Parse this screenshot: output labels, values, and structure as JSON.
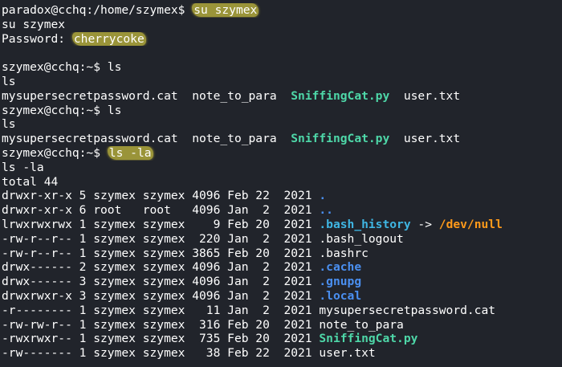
{
  "prompt": {
    "root": "paradox@cchq:/home/szymex$ ",
    "user": "szymex@cchq:~$ "
  },
  "commands": {
    "su": "su szymex",
    "ls": "ls",
    "lsla": "ls -la"
  },
  "password": {
    "label": "Password: ",
    "value": "cherrycoke"
  },
  "ls_output": {
    "f1": "mysupersecretpassword.cat",
    "f2": "note_to_para",
    "f3": "SniffingCat.py",
    "f4": "user.txt"
  },
  "lsla": {
    "total": "total 44",
    "rows": [
      {
        "prefix": "drwxr-xr-x 5 szymex szymex 4096 Feb 22  2021 ",
        "name": "."
      },
      {
        "prefix": "drwxr-xr-x 6 root   root   4096 Jan  2  2021 ",
        "name": ".."
      },
      {
        "prefix": "lrwxrwxrwx 1 szymex szymex    9 Feb 20  2021 ",
        "name": ".bash_history",
        "arrow": " -> ",
        "target": "/dev/null"
      },
      {
        "prefix": "-rw-r--r-- 1 szymex szymex  220 Jan  2  2021 ",
        "name": ".bash_logout"
      },
      {
        "prefix": "-rw-r--r-- 1 szymex szymex 3865 Feb 20  2021 ",
        "name": ".bashrc"
      },
      {
        "prefix": "drwx------ 2 szymex szymex 4096 Jan  2  2021 ",
        "name": ".cache"
      },
      {
        "prefix": "drwx------ 3 szymex szymex 4096 Jan  2  2021 ",
        "name": ".gnupg"
      },
      {
        "prefix": "drwxrwxr-x 3 szymex szymex 4096 Jan  2  2021 ",
        "name": ".local"
      },
      {
        "prefix": "-r-------- 1 szymex szymex   11 Jan  2  2021 ",
        "name": "mysupersecretpassword.cat"
      },
      {
        "prefix": "-rw-rw-r-- 1 szymex szymex  316 Feb 20  2021 ",
        "name": "note_to_para"
      },
      {
        "prefix": "-rwxrwxr-- 1 szymex szymex  735 Feb 20  2021 ",
        "name": "SniffingCat.py"
      },
      {
        "prefix": "-rw------- 1 szymex szymex   38 Feb 22  2021 ",
        "name": "user.txt"
      }
    ]
  },
  "colors": {
    "background": "#21242b",
    "text": "#ffffff",
    "python_file": "#4ed7a8",
    "directory": "#4a8ff0",
    "symlink": "#3fb6e3",
    "link_target": "#ff9a1a",
    "highlight": "#fff046"
  }
}
